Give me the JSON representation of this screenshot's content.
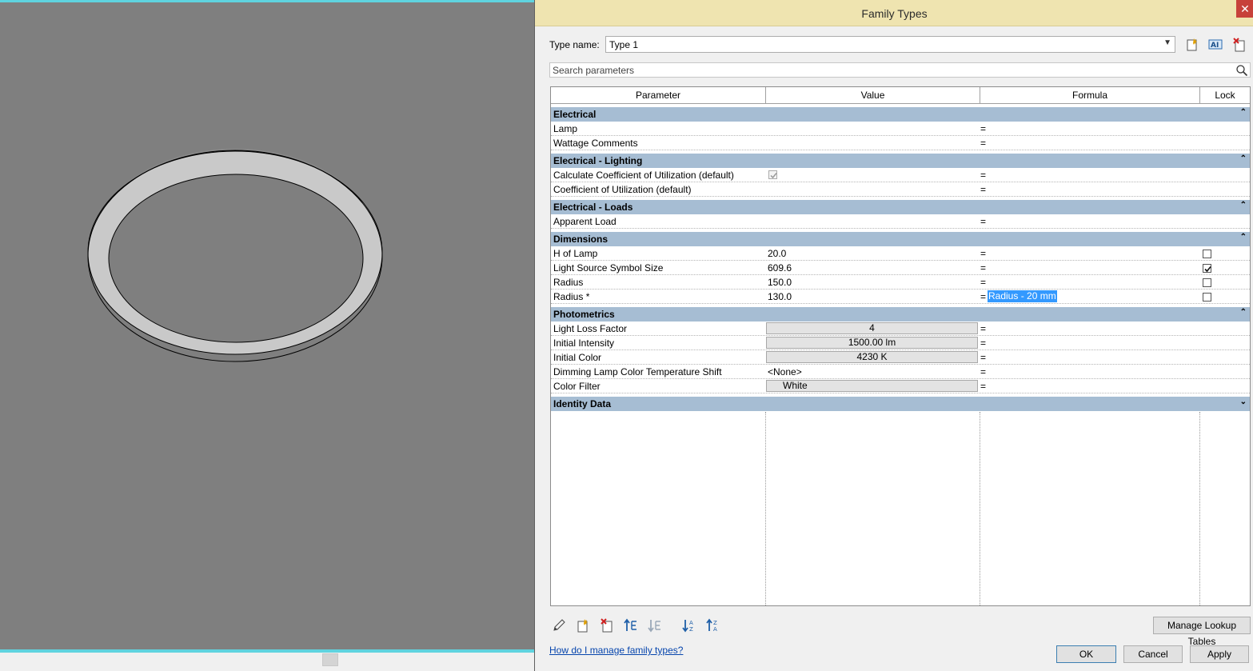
{
  "dialog": {
    "title": "Family Types",
    "close_glyph": "✕",
    "type_name_label": "Type name:",
    "type_name_value": "Type 1",
    "search_placeholder": "Search parameters"
  },
  "columns": [
    "Parameter",
    "Value",
    "Formula",
    "Lock"
  ],
  "groups": [
    {
      "label": "Electrical",
      "expanded": true,
      "rows": [
        {
          "parameter": "Lamp",
          "value": "",
          "formula": "="
        },
        {
          "parameter": "Wattage Comments",
          "value": "",
          "formula": "="
        }
      ]
    },
    {
      "label": "Electrical - Lighting",
      "expanded": true,
      "rows": [
        {
          "parameter": "Calculate Coefficient of Utilization (default)",
          "value_checkbox": "checked-disabled",
          "formula": "="
        },
        {
          "parameter": "Coefficient of Utilization (default)",
          "value": "",
          "formula": "="
        }
      ]
    },
    {
      "label": "Electrical - Loads",
      "expanded": true,
      "rows": [
        {
          "parameter": "Apparent Load",
          "value": "",
          "formula": "="
        }
      ]
    },
    {
      "label": "Dimensions",
      "expanded": true,
      "rows": [
        {
          "parameter": "H of Lamp",
          "value": "20.0",
          "formula": "=",
          "lock": false
        },
        {
          "parameter": "Light Source Symbol Size",
          "value": "609.6",
          "formula": "=",
          "lock": true
        },
        {
          "parameter": "Radius",
          "value": "150.0",
          "formula": "=",
          "lock": false
        },
        {
          "parameter": "Radius *",
          "value": "130.0",
          "formula": "=",
          "formula_expr": "Radius - 20 mm",
          "lock": false
        }
      ]
    },
    {
      "label": "Photometrics",
      "expanded": true,
      "rows": [
        {
          "parameter": "Light Loss Factor",
          "value": "4",
          "formula": "="
        },
        {
          "parameter": "Initial Intensity",
          "value": "1500.00 lm",
          "formula": "="
        },
        {
          "parameter": "Initial Color",
          "value": "4230 K",
          "formula": "="
        },
        {
          "parameter": "Dimming Lamp Color Temperature Shift",
          "value": "<None>",
          "formula": "="
        },
        {
          "parameter": "Color Filter",
          "value": "White",
          "formula": "="
        }
      ]
    },
    {
      "label": "Identity Data",
      "expanded": false,
      "rows": []
    }
  ],
  "chevrons": {
    "up": "⌃",
    "down": "⌄"
  },
  "footer": {
    "manage_lookup_label": "Manage Lookup Tables",
    "help_link": "How do I manage family types?",
    "ok_label": "OK",
    "cancel_label": "Cancel",
    "apply_label": "Apply"
  },
  "colors": {
    "title_bar": "#efe4b0",
    "group_header": "#a6bdd3",
    "selection": "#3399ff",
    "viewport": "#7f7f7f",
    "viewport_accent": "#5fd3df"
  }
}
